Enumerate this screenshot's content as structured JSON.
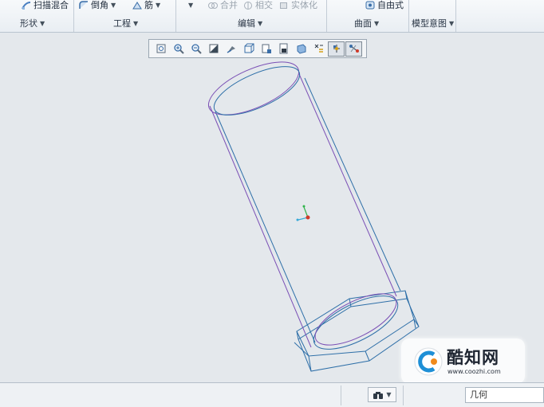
{
  "ribbon": {
    "tools": {
      "sweep_blend": "扫描混合",
      "round": "倒角",
      "rib": "筋",
      "merge": "合并",
      "intersect": "相交",
      "solidify": "实体化",
      "freestyle": "自由式"
    },
    "groups": {
      "shapes": "形状",
      "engineering": "工程",
      "editing": "编辑",
      "surfaces": "曲面",
      "model_intent": "模型意图"
    }
  },
  "view_toolbar": {
    "buttons": [
      "refit-icon",
      "zoom-in-icon",
      "zoom-out-icon",
      "repaint-icon",
      "reorient-icon",
      "display-style-icon",
      "saved-orientations-icon",
      "view-manager-icon",
      "perspective-icon",
      "datum-display-icon",
      "spin-center-icon",
      "annotation-display-icon"
    ]
  },
  "colors": {
    "model_edges": "#2e6fa8",
    "model_silhouette": "#7a4fb5",
    "background": "#e4e8ec",
    "csys_x": "#d03a2a",
    "csys_y": "#2fb34a",
    "csys_z": "#37a9d8"
  },
  "watermark": {
    "name": "酷知网",
    "url": "www.coozhi.com"
  },
  "statusbar": {
    "filter_value": "几何"
  }
}
